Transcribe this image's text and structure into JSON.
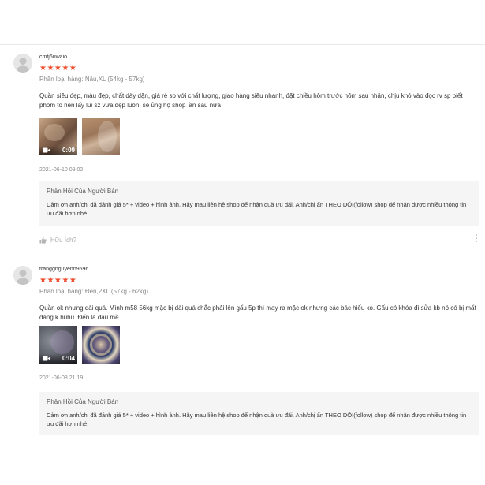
{
  "reviews": [
    {
      "username": "cmtj6uwaio",
      "stars": "★★★★★",
      "rating": 5,
      "variation": "Phân loại hàng: Nâu,XL (54kg - 57kg)",
      "comment": "Quần siêu đẹp, màu đẹp, chất dày dặn, giá rẻ so với chất lượng, giao hàng siêu nhanh, đặt chiều hôm trước hôm sau nhận, chịu khó vào đọc rv sp biết phom to nên lấy lùi sz vừa đẹp luôn, sẽ ủng hộ shop lần sau nữa",
      "video_duration": "0:09",
      "timestamp": "2021-06-10 09:02",
      "reply_title": "Phản Hồi Của Người Bán",
      "reply_text": "Cảm ơn anh/chị đã đánh giá 5* + video + hình ảnh. Hãy mau liên hệ shop để nhận quà ưu đãi. Anh/chị ấn THEO DÕI(follow) shop để nhận được nhiều thông tin ưu đãi hơn nhé.",
      "helpful_label": "Hữu Ích?"
    },
    {
      "username": "tranggnguyenn9596",
      "stars": "★★★★★",
      "rating": 5,
      "variation": "Phân loại hàng: Đen,2XL (57kg - 62kg)",
      "comment": "Quần ok nhưng dài quá. Mình m58 56kg mặc bị dài quá chắc phải lên gấu 5p thì may ra mặc ok nhưng các bác hiểu ko. Gấu có khóa đi sửa kb nó có bị mất dáng k huhu. Đến là đau mề",
      "video_duration": "0:04",
      "timestamp": "2021-06-08 21:19",
      "reply_title": "Phản Hồi Của Người Bán",
      "reply_text": "Cảm ơn anh/chị đã đánh giá 5* + video + hình ảnh. Hãy mau liên hệ shop để nhận quà ưu đãi. Anh/chị ấn THEO DÕI(follow) shop để nhận được nhiều thông tin ưu đãi hơn nhé."
    }
  ],
  "colors": {
    "star": "#ee4d2d",
    "reply_bg": "#f5f5f5",
    "muted": "#8a8a8a"
  },
  "icons": {
    "avatar": "user-avatar-icon",
    "video": "video-camera-icon",
    "like": "thumbs-up-icon",
    "more": "more-vertical-icon"
  }
}
